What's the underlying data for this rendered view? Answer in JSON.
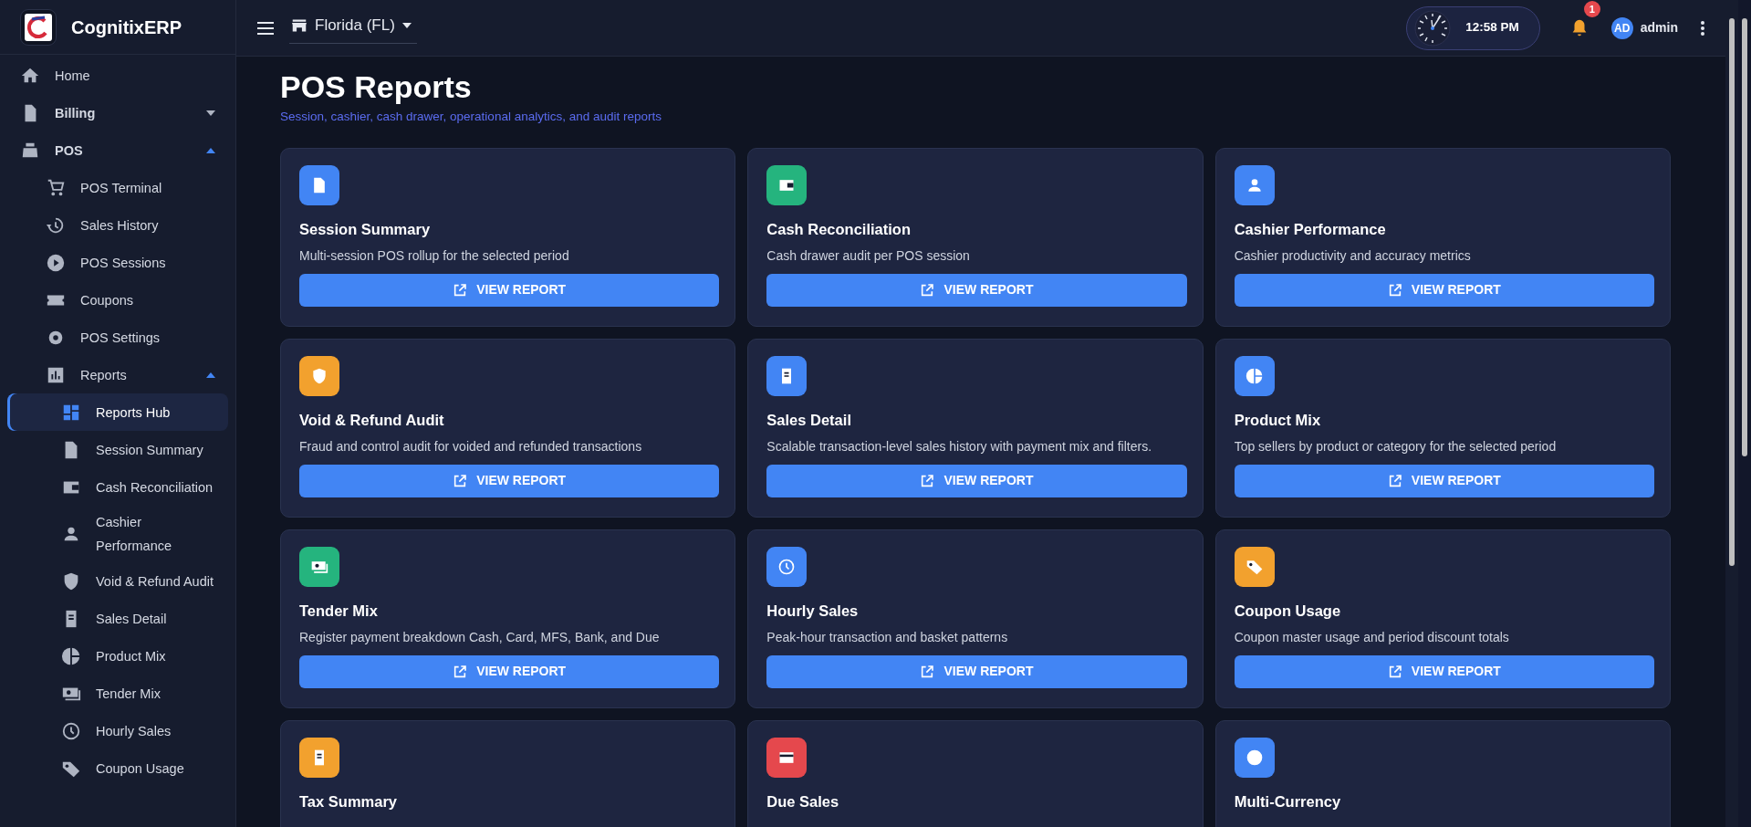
{
  "sidebar": {
    "brand": "CognitixERP",
    "items": [
      {
        "label": "Home",
        "selected": false
      },
      {
        "label": "Billing",
        "selected": false,
        "expanded": false
      },
      {
        "label": "POS",
        "selected": false,
        "expanded": true,
        "children": [
          {
            "label": "POS Terminal",
            "selected": false
          },
          {
            "label": "Sales History",
            "selected": false
          },
          {
            "label": "POS Sessions",
            "selected": false
          },
          {
            "label": "Coupons",
            "selected": false
          },
          {
            "label": "POS Settings",
            "selected": false
          },
          {
            "label": "Reports",
            "selected": false,
            "expanded": true,
            "children": [
              {
                "label": "Reports Hub",
                "selected": true
              },
              {
                "label": "Session Summary",
                "selected": false
              },
              {
                "label": "Cash Reconciliation",
                "selected": false
              },
              {
                "label": "Cashier Performance",
                "selected": false
              },
              {
                "label": "Void & Refund Audit",
                "selected": false
              },
              {
                "label": "Sales Detail",
                "selected": false
              },
              {
                "label": "Product Mix",
                "selected": false
              },
              {
                "label": "Tender Mix",
                "selected": false
              },
              {
                "label": "Hourly Sales",
                "selected": false
              },
              {
                "label": "Coupon Usage",
                "selected": false
              }
            ]
          }
        ]
      }
    ]
  },
  "header": {
    "location": "Florida (FL)",
    "time": "12:58 PM",
    "notification_count": "1",
    "user_initials": "AD",
    "user_name": "admin"
  },
  "page": {
    "title": "POS Reports",
    "subtitle": "Session, cashier, cash drawer, operational analytics, and audit reports"
  },
  "reports": [
    {
      "title": "Session Summary",
      "description": "Multi-session POS rollup for the selected period",
      "color": "#4285f4",
      "button": "VIEW REPORT"
    },
    {
      "title": "Cash Reconciliation",
      "description": "Cash drawer audit per POS session",
      "color": "#25b47e",
      "button": "VIEW REPORT"
    },
    {
      "title": "Cashier Performance",
      "description": "Cashier productivity and accuracy metrics",
      "color": "#4285f4",
      "button": "VIEW REPORT"
    },
    {
      "title": "Void & Refund Audit",
      "description": "Fraud and control audit for voided and refunded transactions",
      "color": "#f2a12e",
      "button": "VIEW REPORT"
    },
    {
      "title": "Sales Detail",
      "description": "Scalable transaction-level sales history with payment mix and filters.",
      "color": "#4285f4",
      "button": "VIEW REPORT"
    },
    {
      "title": "Product Mix",
      "description": "Top sellers by product or category for the selected period",
      "color": "#4285f4",
      "button": "VIEW REPORT"
    },
    {
      "title": "Tender Mix",
      "description": "Register payment breakdown Cash, Card, MFS, Bank, and Due",
      "color": "#25b47e",
      "button": "VIEW REPORT"
    },
    {
      "title": "Hourly Sales",
      "description": "Peak-hour transaction and basket patterns",
      "color": "#4285f4",
      "button": "VIEW REPORT"
    },
    {
      "title": "Coupon Usage",
      "description": "Coupon master usage and period discount totals",
      "color": "#f2a12e",
      "button": "VIEW REPORT"
    },
    {
      "title": "Tax Summary",
      "color": "#f2a12e"
    },
    {
      "title": "Due Sales",
      "color": "#e5484d"
    },
    {
      "title": "Multi-Currency",
      "color": "#4285f4"
    }
  ]
}
